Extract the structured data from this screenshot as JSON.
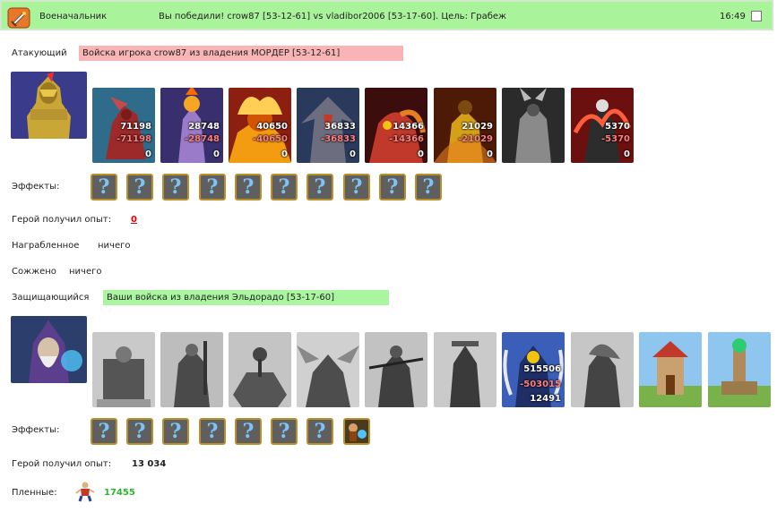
{
  "header": {
    "title": "Военачальник",
    "message": "Вы победили! crow87 [53-12-61] vs vladibor2006 [53-17-60]. Цель: Грабеж",
    "time": "16:49"
  },
  "attacker": {
    "label": "Атакующий",
    "banner": "Войска игрока crow87 из владения МОРДЕР [53-12-61]",
    "units": [
      {
        "count": "71198",
        "loss": "-71198",
        "left": "0"
      },
      {
        "count": "28748",
        "loss": "-28748",
        "left": "0"
      },
      {
        "count": "40650",
        "loss": "-40650",
        "left": "0"
      },
      {
        "count": "36833",
        "loss": "-36833",
        "left": "0"
      },
      {
        "count": "14366",
        "loss": "-14366",
        "left": "0"
      },
      {
        "count": "21029",
        "loss": "-21029",
        "left": "0"
      },
      {
        "count": "",
        "loss": "",
        "left": ""
      },
      {
        "count": "5370",
        "loss": "-5370",
        "left": "0"
      }
    ],
    "effects_label": "Эффекты:",
    "exp_label": "Герой получил опыт:",
    "exp_value": "0",
    "loot_label": "Награбленное",
    "loot_value": "ничего",
    "burned_label": "Сожжено",
    "burned_value": "ничего"
  },
  "defender": {
    "label": "Защищающийся",
    "banner": "Ваши войска из владения Эльдорадо [53-17-60]",
    "units": [
      {
        "count": "",
        "loss": "",
        "left": ""
      },
      {
        "count": "",
        "loss": "",
        "left": ""
      },
      {
        "count": "",
        "loss": "",
        "left": ""
      },
      {
        "count": "",
        "loss": "",
        "left": ""
      },
      {
        "count": "",
        "loss": "",
        "left": ""
      },
      {
        "count": "",
        "loss": "",
        "left": ""
      },
      {
        "count": "515506",
        "loss": "-503015",
        "left": "12491"
      },
      {
        "count": "",
        "loss": "",
        "left": ""
      },
      {
        "count": "",
        "loss": "",
        "left": ""
      },
      {
        "count": "",
        "loss": "",
        "left": ""
      }
    ],
    "effects_label": "Эффекты:",
    "exp_label": "Герой получил опыт:",
    "exp_value": "13 034",
    "prisoners_label": "Пленные:",
    "prisoners_value": "17455"
  },
  "effect_icon_glyph": "?",
  "colors": {
    "header_bg": "#a9f39a",
    "attacker_banner": "#f9b5b5",
    "defender_banner": "#a9f5a0",
    "exp_zero": "#e00000",
    "prisoners": "#2db52d"
  }
}
